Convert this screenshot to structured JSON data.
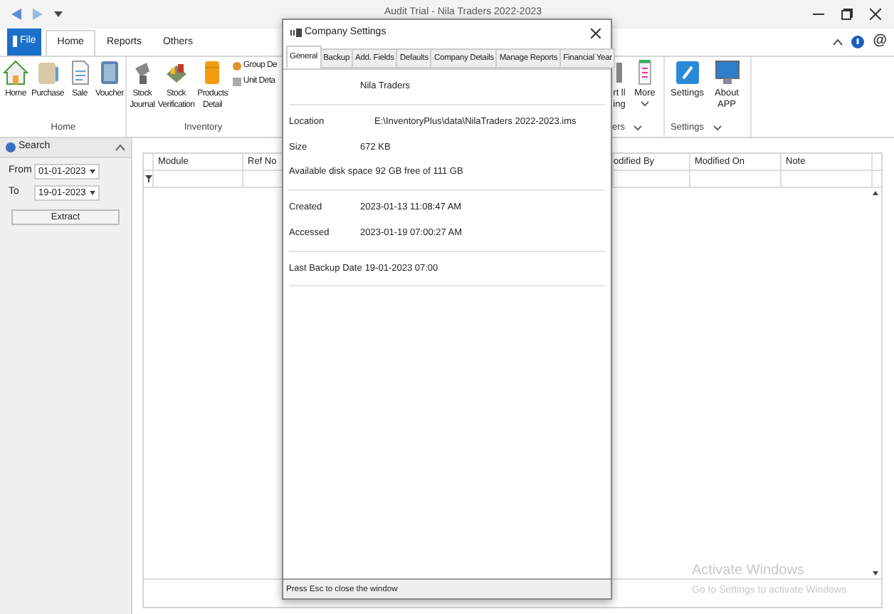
{
  "window": {
    "title": "Audit Trial - Nila Traders 2022-2023"
  },
  "ribbon_tabs": [
    {
      "label": "File",
      "kind": "file",
      "selected": false
    },
    {
      "label": "Home",
      "kind": "tab",
      "selected": true
    },
    {
      "label": "Reports",
      "kind": "tab",
      "selected": false
    },
    {
      "label": "Others",
      "kind": "tab",
      "selected": false
    }
  ],
  "header_right": {
    "at_sign": "@"
  },
  "ribbon_left": [
    {
      "label": "Home",
      "buttons": [
        "Home",
        "Purchase",
        "Sale",
        "Voucher"
      ]
    },
    {
      "label": "Inventory",
      "buttons": [
        "Stock Journal",
        "Stock Verification",
        "Products Detail"
      ],
      "small": [
        "Group De",
        "Unit Deta"
      ]
    }
  ],
  "ribbon_right": [
    {
      "label": "ers",
      "buttons": [
        {
          "label": "rt lling",
          "dropdown": false
        },
        {
          "label": "More",
          "dropdown": true
        }
      ]
    },
    {
      "label": "Settings",
      "buttons": [
        {
          "label": "Settings",
          "dropdown": false
        },
        {
          "label": "About APP",
          "dropdown": false
        }
      ]
    }
  ],
  "search_panel": {
    "title": "Search",
    "from_label": "From",
    "from_value": "01-01-2023",
    "to_label": "To",
    "to_value": "19-01-2023",
    "button": "Extract"
  },
  "grid": {
    "columns": [
      "Module",
      "Ref No",
      "odified By",
      "Modified On",
      "Note"
    ]
  },
  "os_notice": {
    "line1": "Activate Windows",
    "line2": "Go to Settings to activate Windows."
  },
  "dialog": {
    "title": "Company Settings",
    "tabs": [
      {
        "label": "General",
        "selected": true
      },
      {
        "label": "Backup",
        "selected": false
      },
      {
        "label": "Add. Fields",
        "selected": false
      },
      {
        "label": "Defaults",
        "selected": false
      },
      {
        "label": "Company Details",
        "selected": false
      },
      {
        "label": "Manage Reports",
        "selected": false
      },
      {
        "label": "Financial Year",
        "selected": false
      }
    ],
    "company_name": "Nila Traders",
    "sections": [
      [
        {
          "label": "Location",
          "value": "E:\\InventoryPlus\\data\\NilaTraders 2022-2023.ims"
        },
        {
          "label": "Size",
          "value": "672 KB"
        },
        {
          "label": "Available disk space",
          "value": "92 GB free of 111 GB"
        }
      ],
      [
        {
          "label": "Created",
          "value": "2023-01-13 11:08:47 AM"
        },
        {
          "label": "Accessed",
          "value": "2023-01-19 07:00:27 AM"
        }
      ],
      [
        {
          "label": "Last Backup Date",
          "value": "19-01-2023 07:00"
        }
      ]
    ],
    "status": "Press Esc to close the window"
  }
}
